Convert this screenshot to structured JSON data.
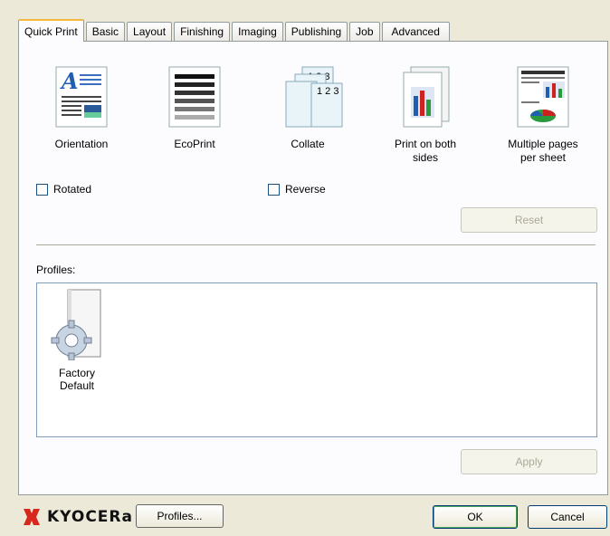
{
  "tabs": [
    {
      "label": "Quick Print",
      "active": true
    },
    {
      "label": "Basic"
    },
    {
      "label": "Layout"
    },
    {
      "label": "Finishing"
    },
    {
      "label": "Imaging"
    },
    {
      "label": "Publishing"
    },
    {
      "label": "Job"
    },
    {
      "label": "Advanced"
    }
  ],
  "features": {
    "orientation": "Orientation",
    "ecoprint": "EcoPrint",
    "collate": "Collate",
    "duplex_line1": "Print on both",
    "duplex_line2": "sides",
    "multi_line1": "Multiple pages",
    "multi_line2": "per sheet"
  },
  "checkboxes": {
    "rotated": "Rotated",
    "reverse": "Reverse"
  },
  "reset_button": "Reset",
  "profiles_label": "Profiles:",
  "profile_item": {
    "line1": "Factory",
    "line2": "Default"
  },
  "apply_button": "Apply",
  "footer": {
    "brand": "KYOCERa",
    "profiles_button": "Profiles...",
    "ok_button": "OK",
    "cancel_button": "Cancel"
  },
  "colors": {
    "accent": "#f5b83c",
    "brand_red": "#d8281e",
    "window_bg": "#ece9d8"
  }
}
